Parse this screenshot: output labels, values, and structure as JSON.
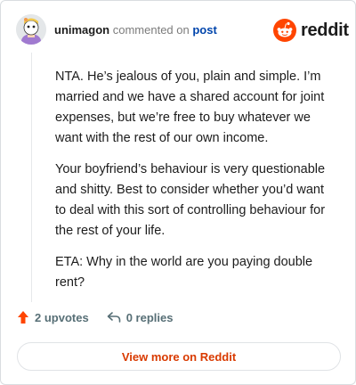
{
  "header": {
    "username": "unimagon",
    "commented_on": "commented on",
    "post_link": "post",
    "logo_text": "reddit"
  },
  "comment": {
    "paragraphs": [
      "NTA. He’s jealous of you, plain and simple. I’m married and we have a shared account for joint expenses, but we’re free to buy whatever we want with the rest of our own income.",
      "Your boyfriend’s behaviour is very questionable and shitty. Best to consider whether you’d want to deal with this sort of controlling behaviour for the rest of your life.",
      "ETA: Why in the world are you paying double rent?"
    ]
  },
  "actions": {
    "upvotes": "2 upvotes",
    "replies": "0 replies"
  },
  "footer": {
    "view_more": "View more on Reddit"
  },
  "colors": {
    "reddit_orange": "#ff4500",
    "link_blue": "#0045ac",
    "view_more_text": "#d93a00"
  }
}
